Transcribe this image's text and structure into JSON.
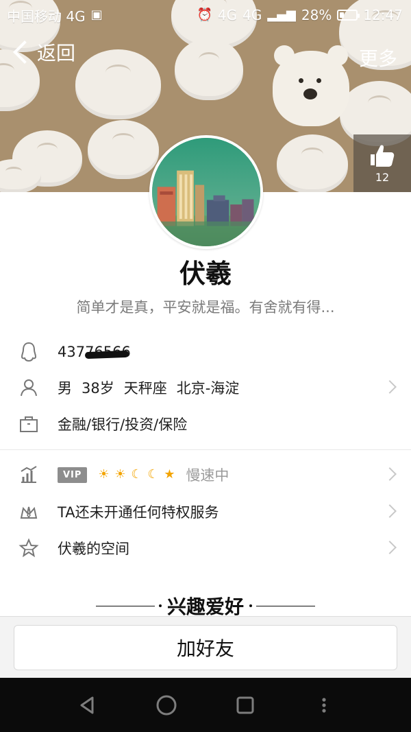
{
  "status_bar": {
    "carrier": "中国移动 4G",
    "alarm_icon": "alarm-icon",
    "network_primary": "4G",
    "network_secondary": "4G",
    "battery_percent": "28%",
    "battery_level": 28,
    "time": "12:47"
  },
  "nav": {
    "back_label": "返回",
    "more_label": "更多"
  },
  "profile": {
    "name": "伏羲",
    "signature": "简单才是真，平安就是福。有舍就有得...",
    "like_count": "12"
  },
  "info": {
    "qq_number_visible": "43776566",
    "basic_gender": "男",
    "basic_age": "38岁",
    "basic_zodiac": "天秤座",
    "basic_location": "北京-海淀",
    "occupation": "金融/银行/投资/保险"
  },
  "services": {
    "vip_badge": "VIP",
    "speed_status": "慢速中",
    "privilege": "TA还未开通任何特权服务",
    "space": "伏羲的空间"
  },
  "interests": {
    "title": "兴趣爱好"
  },
  "actions": {
    "add_friend": "加好友"
  },
  "icons": {
    "back": "back-arrow-icon",
    "thumb": "thumb-up-icon",
    "qq": "qq-icon",
    "user": "user-icon",
    "briefcase": "briefcase-icon",
    "chart": "chart-icon",
    "crown": "crown-icon",
    "star": "star-icon"
  },
  "colors": {
    "header_bg": "#a9906e",
    "accent_gold": "#f3a400",
    "text_gray": "#7b7b7b"
  }
}
